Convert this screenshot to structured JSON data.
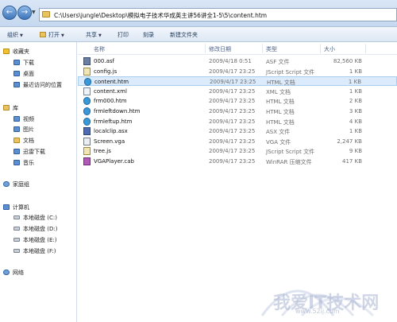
{
  "address": {
    "path": "C:\\Users\\jungle\\Desktop\\模拟电子技术华成英主讲56讲全1-5\\5\\content.htm"
  },
  "nav": {
    "back_icon": "back-arrow-icon",
    "forward_icon": "forward-arrow-icon"
  },
  "toolbar": {
    "organize": "组织",
    "open": "打开",
    "share": "共享",
    "print": "打印",
    "burn": "刻录",
    "new_folder": "新建文件夹"
  },
  "sidebar": {
    "favorites_header": "收藏夹",
    "favorites": [
      "下载",
      "桌面",
      "最近访问的位置"
    ],
    "libraries_header": "库",
    "libraries": [
      "视频",
      "图片",
      "文档",
      "迅雷下载",
      "音乐"
    ],
    "homegroup": "家庭组",
    "computer_header": "计算机",
    "drives": [
      "本地磁盘 (C:)",
      "本地磁盘 (D:)",
      "本地磁盘 (E:)",
      "本地磁盘 (F:)"
    ],
    "network": "网络"
  },
  "columns": {
    "name": "名称",
    "date": "修改日期",
    "type": "类型",
    "size": "大小"
  },
  "files": [
    {
      "name": "000.asf",
      "date": "2009/4/18 0:51",
      "type": "ASF 文件",
      "size": "82,560 KB",
      "icon": "asf"
    },
    {
      "name": "config.js",
      "date": "2009/4/17 23:25",
      "type": "JScript Script 文件",
      "size": "1 KB",
      "icon": "js"
    },
    {
      "name": "content.htm",
      "date": "2009/4/17 23:25",
      "type": "HTML 文档",
      "size": "1 KB",
      "icon": "ie",
      "selected": true
    },
    {
      "name": "content.xml",
      "date": "2009/4/17 23:25",
      "type": "XML 文档",
      "size": "1 KB",
      "icon": "xml"
    },
    {
      "name": "frm000.htm",
      "date": "2009/4/17 23:25",
      "type": "HTML 文档",
      "size": "2 KB",
      "icon": "ie"
    },
    {
      "name": "frmleftdown.htm",
      "date": "2009/4/17 23:25",
      "type": "HTML 文档",
      "size": "3 KB",
      "icon": "ie"
    },
    {
      "name": "frmleftup.htm",
      "date": "2009/4/17 23:25",
      "type": "HTML 文档",
      "size": "4 KB",
      "icon": "ie"
    },
    {
      "name": "localclip.asx",
      "date": "2009/4/17 23:25",
      "type": "ASX 文件",
      "size": "1 KB",
      "icon": "asx"
    },
    {
      "name": "Screen.vga",
      "date": "2009/4/17 23:25",
      "type": "VGA 文件",
      "size": "2,247 KB",
      "icon": "vga"
    },
    {
      "name": "tree.js",
      "date": "2009/4/17 23:25",
      "type": "JScript Script 文件",
      "size": "9 KB",
      "icon": "js"
    },
    {
      "name": "VGAPlayer.cab",
      "date": "2009/4/17 23:25",
      "type": "WinRAR 压缩文件",
      "size": "417 KB",
      "icon": "cab"
    }
  ],
  "watermark": {
    "main": "我爱IT技术网",
    "sub": "www.52ij.com"
  }
}
